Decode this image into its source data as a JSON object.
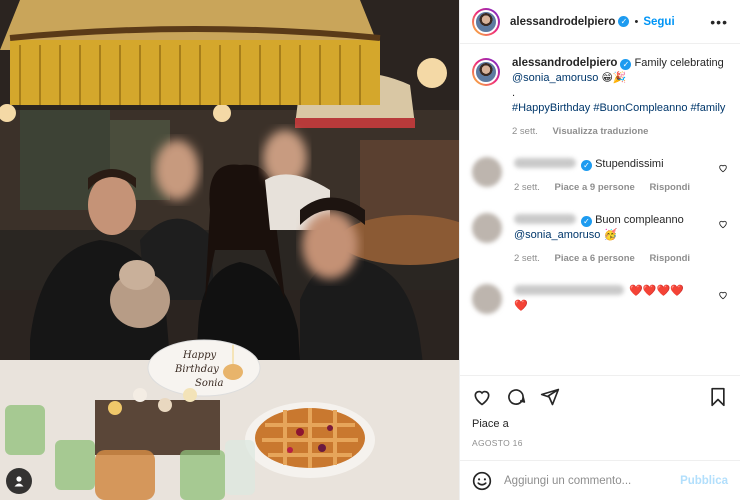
{
  "header": {
    "username": "alessandrodelpiero",
    "follow_label": "Segui",
    "more_label": "•••"
  },
  "caption": {
    "username": "alessandrodelpiero",
    "text_before": "Family celebrating ",
    "mention": "@sonia_amoruso",
    "emojis": "😁🎉",
    "dot": ".",
    "hashtags": "#HappyBirthday #BuonCompleanno #family",
    "time": "2 sett.",
    "translate": "Visualizza traduzione"
  },
  "comments": [
    {
      "text": "Stupendissimi",
      "time": "2 sett.",
      "likes": "Piace a 9 persone",
      "reply": "Rispondi"
    },
    {
      "text": "Buon compleanno ",
      "mention": "@sonia_amoruso",
      "emoji": "🥳",
      "time": "2 sett.",
      "likes": "Piace a 6 persone",
      "reply": "Rispondi"
    },
    {
      "text": "❤️❤️❤️❤️",
      "extra": "❤️"
    }
  ],
  "actions": {
    "likes_text": "Piace a",
    "date": "AGOSTO 16"
  },
  "add_comment": {
    "placeholder": "Aggiungi un commento...",
    "publish_label": "Pubblica",
    "emoji_icon": "smiley-icon"
  },
  "photo": {
    "cake_text_line1": "Happy",
    "cake_text_line2": "Birthday",
    "cake_text_line3": "Sonia"
  },
  "colors": {
    "accent": "#0095f6",
    "verified": "#1d9bf0",
    "link": "#00376b",
    "muted": "#8e8e8e",
    "heart": "#ed4956",
    "publish_disabled": "#b2dffc"
  }
}
